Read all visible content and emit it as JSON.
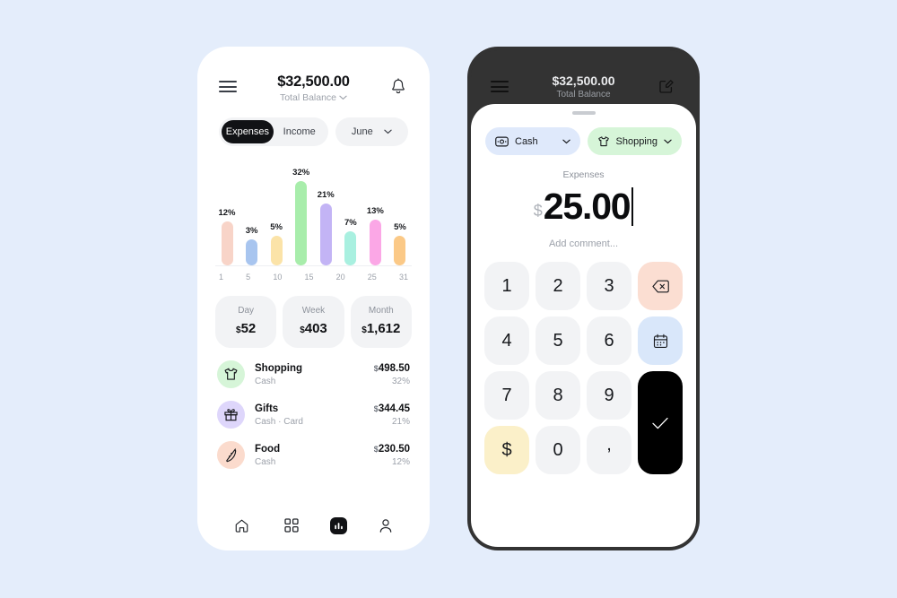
{
  "theme": {
    "page_bg": "#e4edfb",
    "accent_dark": "#111215",
    "frame_dark": "#333333",
    "muted": "#9ca1aa"
  },
  "left_phone": {
    "header": {
      "menu_icon": "hamburger-icon",
      "balance_amount": "$32,500.00",
      "balance_label": "Total Balance",
      "balance_chevron": "chevron-down-icon",
      "notification_icon": "bell-icon"
    },
    "segments": [
      {
        "label": "Expenses",
        "active": true
      },
      {
        "label": "Income",
        "active": false
      }
    ],
    "month_selector": {
      "label": "June",
      "icon": "chevron-down-icon"
    },
    "chart_data": {
      "type": "bar",
      "title": "",
      "xlabel": "",
      "ylabel": "",
      "grid": false,
      "legend": "none",
      "categories": [
        "1",
        "5",
        "10",
        "15",
        "20",
        "25",
        "31"
      ],
      "x_tick_labels": [
        "1",
        "5",
        "10",
        "15",
        "20",
        "25",
        "31"
      ],
      "bars": [
        {
          "label": "12%",
          "value": 12,
          "color": "#f8d4c8"
        },
        {
          "label": "3%",
          "value": 3,
          "color": "#a8c5ef"
        },
        {
          "label": "5%",
          "value": 5,
          "color": "#fbe3a8"
        },
        {
          "label": "32%",
          "value": 32,
          "color": "#a8edab"
        },
        {
          "label": "21%",
          "value": 21,
          "color": "#c3b4f5"
        },
        {
          "label": "7%",
          "value": 7,
          "color": "#a9f0e0"
        },
        {
          "label": "13%",
          "value": 13,
          "color": "#fba7e6"
        },
        {
          "label": "5%",
          "value": 5,
          "color": "#fbc987"
        }
      ],
      "values": [
        12,
        3,
        5,
        32,
        21,
        7,
        13,
        5
      ],
      "ylim": [
        0,
        32
      ]
    },
    "stats": [
      {
        "title": "Day",
        "currency": "$",
        "value": "52"
      },
      {
        "title": "Week",
        "currency": "$",
        "value": "403"
      },
      {
        "title": "Month",
        "currency": "$",
        "value": "1,612"
      }
    ],
    "transactions": [
      {
        "icon": "tshirt-icon",
        "icon_bg": "#d6f5d8",
        "name": "Shopping",
        "source": "Cash",
        "currency": "$",
        "amount": "498.50",
        "percent": "32%"
      },
      {
        "icon": "gift-icon",
        "icon_bg": "#ded6fb",
        "name": "Gifts",
        "source": "Cash · Card",
        "currency": "$",
        "amount": "344.45",
        "percent": "21%"
      },
      {
        "icon": "pizza-icon",
        "icon_bg": "#fbdbcd",
        "name": "Food",
        "source": "Cash",
        "currency": "$",
        "amount": "230.50",
        "percent": "12%"
      }
    ],
    "nav": [
      {
        "icon": "home-icon",
        "selected": false
      },
      {
        "icon": "grid-icon",
        "selected": false
      },
      {
        "icon": "bar-chart-icon",
        "selected": true
      },
      {
        "icon": "person-icon",
        "selected": false
      }
    ]
  },
  "right_phone": {
    "header": {
      "menu_icon": "hamburger-icon",
      "balance_amount": "$32,500.00",
      "balance_label": "Total Balance",
      "edit_icon": "edit-pencil-icon"
    },
    "sheet": {
      "grabber": "drag-handle",
      "chips": [
        {
          "icon": "banknote-icon",
          "label": "Cash",
          "chevron": "chevron-down-icon",
          "color": "#dfe9fb"
        },
        {
          "icon": "tshirt-icon",
          "label": "Shopping",
          "chevron": "chevron-down-icon",
          "color": "#d6f5d8"
        }
      ],
      "amount": {
        "kind_label": "Expenses",
        "currency": "$",
        "value": "25.00",
        "comment_placeholder": "Add comment..."
      },
      "keypad": [
        {
          "label": "1",
          "name": "key-1",
          "style": "plain"
        },
        {
          "label": "2",
          "name": "key-2",
          "style": "plain"
        },
        {
          "label": "3",
          "name": "key-3",
          "style": "plain"
        },
        {
          "label": "",
          "name": "backspace-key",
          "style": "peach",
          "icon": "backspace-icon"
        },
        {
          "label": "4",
          "name": "key-4",
          "style": "plain"
        },
        {
          "label": "5",
          "name": "key-5",
          "style": "plain"
        },
        {
          "label": "6",
          "name": "key-6",
          "style": "plain"
        },
        {
          "label": "",
          "name": "calendar-key",
          "style": "blue",
          "icon": "calendar-icon"
        },
        {
          "label": "7",
          "name": "key-7",
          "style": "plain"
        },
        {
          "label": "8",
          "name": "key-8",
          "style": "plain"
        },
        {
          "label": "9",
          "name": "key-9",
          "style": "plain"
        },
        {
          "label": "",
          "name": "confirm-key",
          "style": "ok",
          "icon": "check-icon"
        },
        {
          "label": "$",
          "name": "currency-key",
          "style": "cream"
        },
        {
          "label": "0",
          "name": "key-0",
          "style": "plain"
        },
        {
          "label": ",",
          "name": "comma-key",
          "style": "plain"
        }
      ]
    }
  }
}
